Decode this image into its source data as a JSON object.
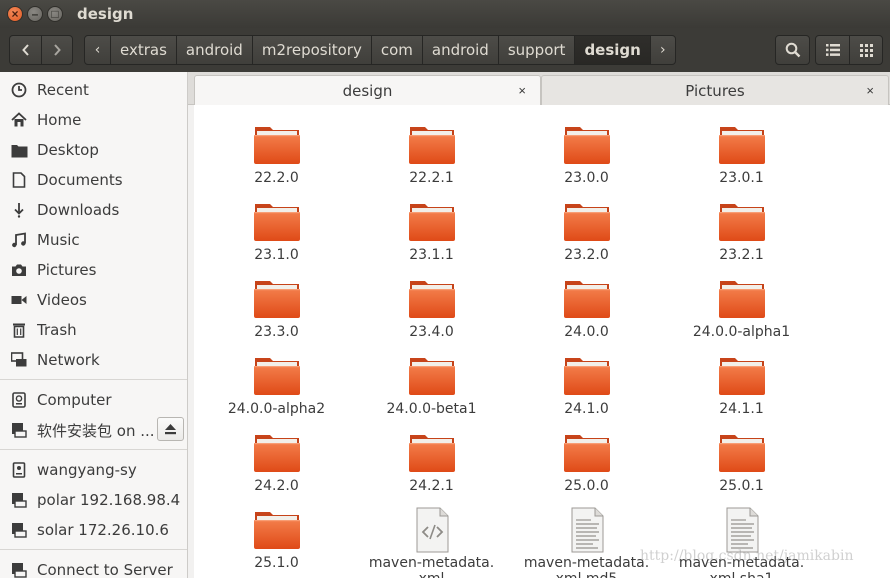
{
  "window": {
    "title": "design",
    "close_glyph": "×",
    "min_glyph": "–",
    "max_glyph": "□"
  },
  "toolbar": {
    "back_icon": "chevron-left-icon",
    "forward_icon": "chevron-right-icon",
    "breadcrumb_left_arrow": "‹",
    "breadcrumb_right_arrow": "›",
    "breadcrumbs": [
      "extras",
      "android",
      "m2repository",
      "com",
      "android",
      "support",
      "design"
    ],
    "active_breadcrumb": "design"
  },
  "sidebar": {
    "places": [
      {
        "label": "Recent",
        "icon": "clock-icon"
      },
      {
        "label": "Home",
        "icon": "home-icon"
      },
      {
        "label": "Desktop",
        "icon": "folder-icon"
      },
      {
        "label": "Documents",
        "icon": "document-icon"
      },
      {
        "label": "Downloads",
        "icon": "download-icon"
      },
      {
        "label": "Music",
        "icon": "music-icon"
      },
      {
        "label": "Pictures",
        "icon": "camera-icon"
      },
      {
        "label": "Videos",
        "icon": "video-icon"
      },
      {
        "label": "Trash",
        "icon": "trash-icon"
      },
      {
        "label": "Network",
        "icon": "network-icon"
      }
    ],
    "devices": [
      {
        "label": "Computer",
        "icon": "drive-icon"
      },
      {
        "label": "软件安装包 on ...",
        "icon": "drive-icon"
      }
    ],
    "network": [
      {
        "label": "wangyang-sy",
        "icon": "computer-icon"
      },
      {
        "label": "polar 192.168.98.4",
        "icon": "server-icon"
      },
      {
        "label": "solar 172.26.10.6",
        "icon": "server-icon"
      }
    ],
    "connect_label": "Connect to Server"
  },
  "tabs": [
    {
      "label": "design",
      "close": "×"
    },
    {
      "label": "Pictures",
      "close": "×"
    }
  ],
  "files": [
    {
      "name": "22.2.0",
      "type": "folder"
    },
    {
      "name": "22.2.1",
      "type": "folder"
    },
    {
      "name": "23.0.0",
      "type": "folder"
    },
    {
      "name": "23.0.1",
      "type": "folder"
    },
    {
      "name": "23.1.0",
      "type": "folder"
    },
    {
      "name": "23.1.1",
      "type": "folder"
    },
    {
      "name": "23.2.0",
      "type": "folder"
    },
    {
      "name": "23.2.1",
      "type": "folder"
    },
    {
      "name": "23.3.0",
      "type": "folder"
    },
    {
      "name": "23.4.0",
      "type": "folder"
    },
    {
      "name": "24.0.0",
      "type": "folder"
    },
    {
      "name": "24.0.0-alpha1",
      "type": "folder"
    },
    {
      "name": "24.0.0-alpha2",
      "type": "folder"
    },
    {
      "name": "24.0.0-beta1",
      "type": "folder"
    },
    {
      "name": "24.1.0",
      "type": "folder"
    },
    {
      "name": "24.1.1",
      "type": "folder"
    },
    {
      "name": "24.2.0",
      "type": "folder"
    },
    {
      "name": "24.2.1",
      "type": "folder"
    },
    {
      "name": "25.0.0",
      "type": "folder"
    },
    {
      "name": "25.0.1",
      "type": "folder"
    },
    {
      "name": "25.1.0",
      "type": "folder"
    },
    {
      "name": "maven-metadata.\nxml",
      "type": "xml"
    },
    {
      "name": "maven-metadata.\nxml.md5",
      "type": "text"
    },
    {
      "name": "maven-metadata.\nxml.sha1",
      "type": "text"
    }
  ],
  "watermark": "http://blog.csdn.net/jamikabin",
  "colors": {
    "folder_orange": "#e95420",
    "toolbar_dark": "#3c3b37"
  }
}
